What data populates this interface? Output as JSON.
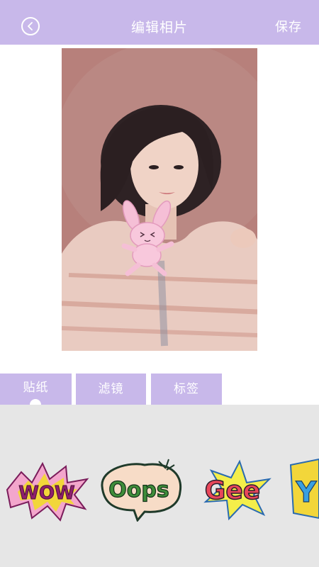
{
  "header": {
    "title": "编辑相片",
    "save_label": "保存"
  },
  "tabs": [
    {
      "label": "贴纸",
      "active": true
    },
    {
      "label": "滤镜",
      "active": false
    },
    {
      "label": "标签",
      "active": false
    }
  ],
  "stickers": [
    {
      "text": "WOW"
    },
    {
      "text": "Oops"
    },
    {
      "text": "Gee"
    },
    {
      "text": "Y"
    }
  ],
  "colors": {
    "accent": "#c8b8ea",
    "panel": "#e6e6e6"
  }
}
